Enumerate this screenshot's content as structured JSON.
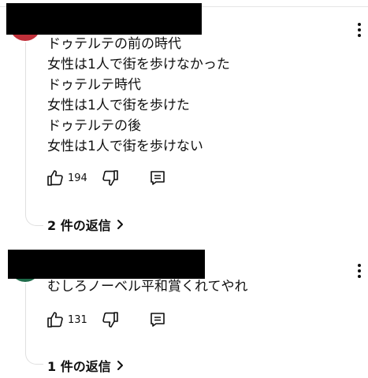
{
  "comments": [
    {
      "lines": [
        "ドゥテルテの前の時代",
        "女性は1人で街を歩けなかった",
        "ドゥテルテ時代",
        "女性は1人で街を歩けた",
        "ドゥテルテの後",
        "女性は1人で街を歩けない"
      ],
      "likes": "194",
      "replies_label": "2 件の返信",
      "avatar_color": "#c0303a"
    },
    {
      "lines": [
        "むしろノーベル平和賞くれてやれ"
      ],
      "likes": "131",
      "replies_label": "1 件の返信",
      "avatar_color": "#1f6b4a"
    }
  ],
  "icons": {
    "like": "thumbs-up-icon",
    "dislike": "thumbs-down-icon",
    "reply": "comment-reply-icon",
    "menu": "more-vert-icon",
    "chevron": "chevron-right-icon"
  }
}
